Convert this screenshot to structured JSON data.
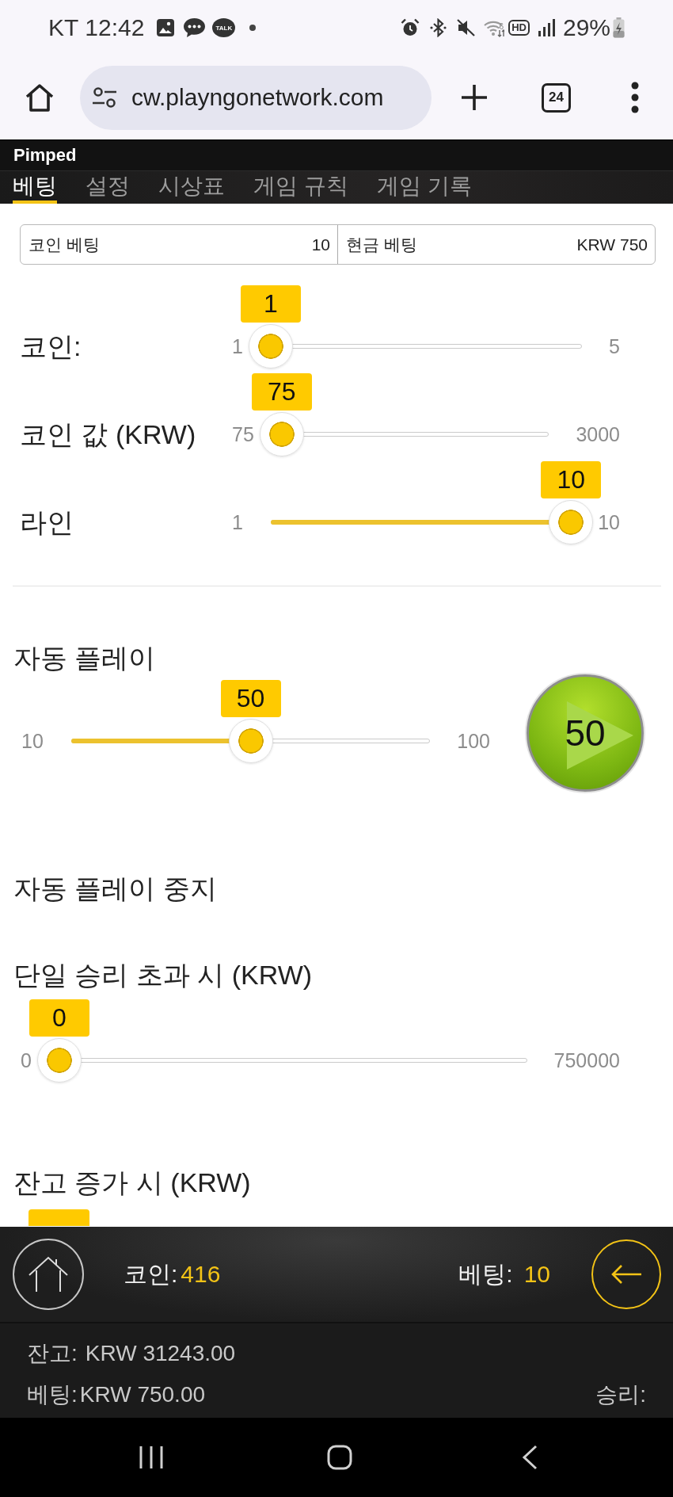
{
  "status_bar": {
    "carrier": "KT",
    "time": "12:42",
    "talk_badge": "TALK",
    "wifi_label": "6",
    "hd_badge": "HD",
    "battery": "29%"
  },
  "browser": {
    "url": "cw.playngonetwork.com",
    "tab_count": "24"
  },
  "game": {
    "title": "Pimped",
    "tabs": [
      {
        "label": "베팅",
        "selected": true
      },
      {
        "label": "설정",
        "selected": false
      },
      {
        "label": "시상표",
        "selected": false
      },
      {
        "label": "게임 규칙",
        "selected": false
      },
      {
        "label": "게임 기록",
        "selected": false
      }
    ]
  },
  "bet_summary": [
    {
      "label": "코인 베팅",
      "value": "10"
    },
    {
      "label": "현금 베팅",
      "value": "KRW 750"
    }
  ],
  "bet_sliders": [
    {
      "label": "코인:",
      "min": "1",
      "max": "5",
      "value": "1",
      "level": 0
    },
    {
      "label": "코인 값 (KRW)",
      "min": "75",
      "max": "3000",
      "value": "75",
      "level": 0
    },
    {
      "label": "라인",
      "min": "1",
      "max": "10",
      "value": "10",
      "level": 1
    }
  ],
  "autoplay": {
    "heading": "자동 플레이",
    "slider": {
      "min": "10",
      "max": "100",
      "value": "50",
      "level": 0.5
    },
    "start_button": "50"
  },
  "stop_autoplay": {
    "heading": "자동 플레이 중지",
    "conditions": [
      {
        "label": "단일 승리 초과 시 (KRW)",
        "min": "0",
        "max": "750000",
        "value": "0",
        "level": 0
      },
      {
        "label": "잔고 증가 시 (KRW)"
      }
    ]
  },
  "footer": {
    "coins_label": "코인:",
    "coins": "416",
    "bet_label": "베팅:",
    "bet": "10",
    "balance_label": "잔고:",
    "balance": "KRW 31243.00",
    "bet_amount_label": "베팅:",
    "bet_amount": "KRW 750.00",
    "win_label": "승리:"
  }
}
